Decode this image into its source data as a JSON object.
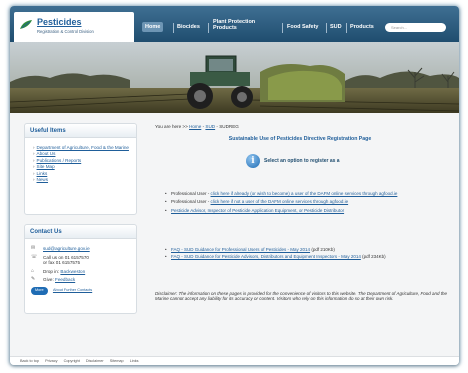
{
  "header": {
    "logo_title": "Pesticides",
    "logo_subtitle": "Registration & Control Division",
    "nav": [
      "Home",
      "Biocides",
      "Plant Protection Products",
      "Food Safety",
      "SUD",
      "Products"
    ],
    "search_placeholder": "Search..."
  },
  "sidebar": {
    "useful_title": "Useful Items",
    "useful_items": [
      "Department of Agriculture, Food & the Marine",
      "About Us",
      "Publications / Reports",
      "Site Map",
      "Links",
      "News"
    ],
    "contact_title": "Contact Us",
    "contact_email": "sud@agriculture.gov.ie",
    "contact_phone": "Call us on 01 6157570",
    "contact_fax": "or fax 01 6157575",
    "drop_in_label": "Drop in:",
    "drop_in_link": "Backweston",
    "give_label": "Give:",
    "give_link": "Feedback",
    "more_badge": "More",
    "more_contacts": "About Further Contacts"
  },
  "main": {
    "breadcrumb_prefix": "You are here >>",
    "breadcrumb_home": "Home",
    "breadcrumb_sep1": "-",
    "breadcrumb_sud": "SUD",
    "breadcrumb_current": "- SUDREG",
    "title": "Sustainable Use of Pesticides Directive Registration Page",
    "select_prompt": "Select an option to register as a",
    "options": [
      {
        "prefix": "Professional User -",
        "link": "click here if already (or wish to become) a user of the DAFM online services through agfood.ie"
      },
      {
        "prefix": "Professional User -",
        "link": "click here if not a user of the DAFM online services through agfood.ie"
      },
      {
        "prefix": "",
        "link": "Pesticide Advisor, Inspector of Pesticide Application Equipment, or Pesticide Distributor"
      }
    ],
    "faqs": [
      {
        "link": "FAQ - SUD Guidance for Professional Users of Pesticides - May 2014",
        "suffix": "(pdf 210Kb)"
      },
      {
        "link": "FAQ - SUD Guidance for Pesticide Advisors, Distributors and Equipment Inspectors - May 2014",
        "suffix": "(pdf 234Kb)"
      }
    ],
    "disclaimer": "Disclaimer: The information on these pages is provided for the convenience of visitors to this website. The Department of Agriculture, Food and the Marine cannot accept any liability for its accuracy or content. Visitors who rely on this information do so at their own risk."
  },
  "footer": {
    "links": [
      "Back to top",
      "Privacy",
      "Copyright",
      "Disclaimer",
      "Sitemap",
      "Links"
    ]
  },
  "colors": {
    "header": "#2a5a7f",
    "link": "#1f5e9a",
    "accent": "#1f6cb4"
  }
}
